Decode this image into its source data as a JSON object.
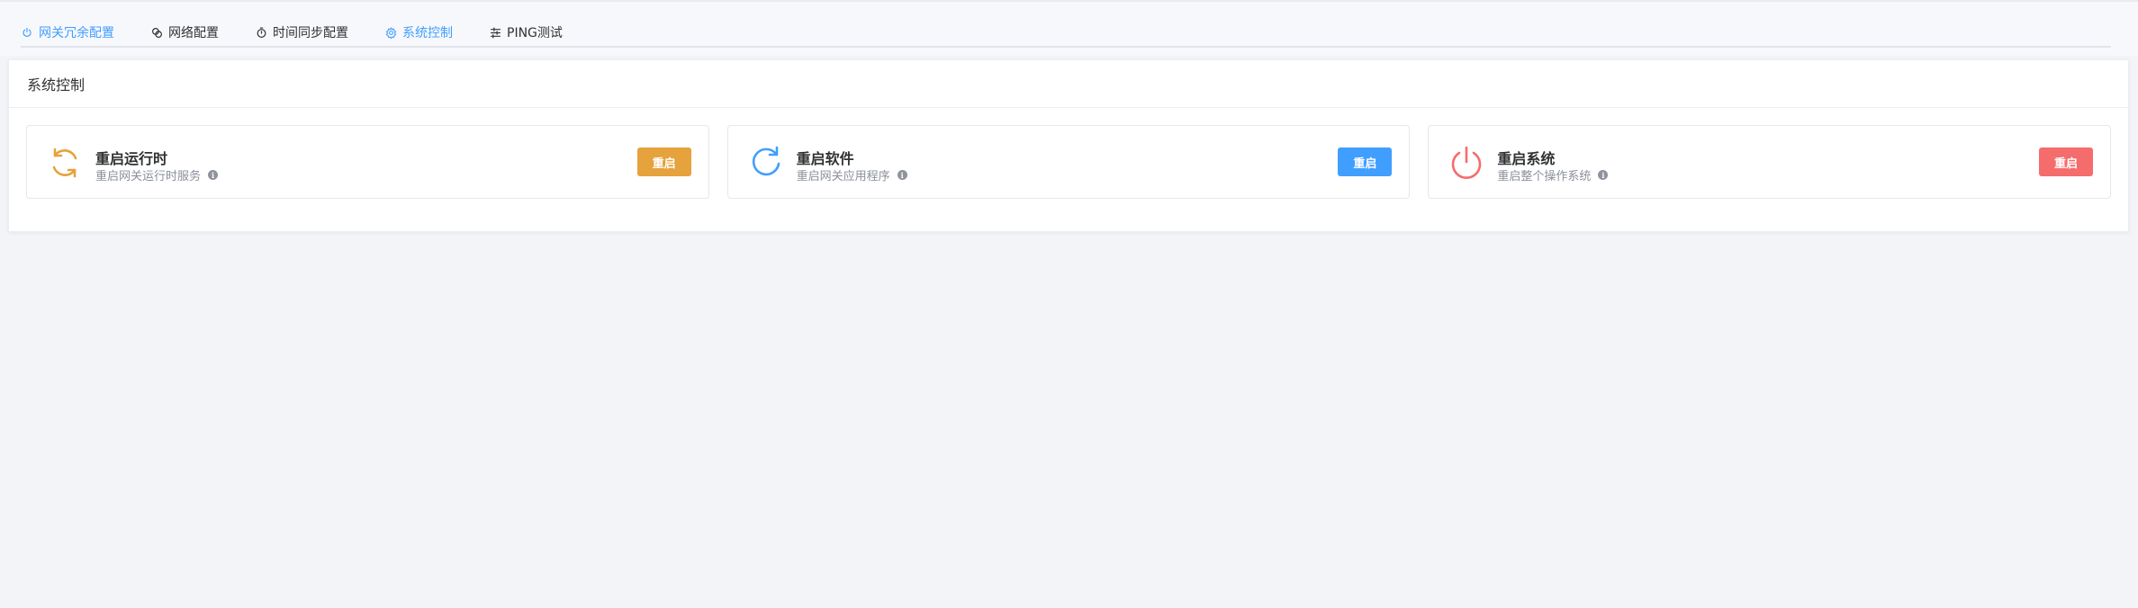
{
  "tabs": [
    {
      "label": "网关冗余配置",
      "icon": "power-icon"
    },
    {
      "label": "网络配置",
      "icon": "link-icon"
    },
    {
      "label": "时间同步配置",
      "icon": "timer-icon"
    },
    {
      "label": "系统控制",
      "icon": "gear-icon"
    },
    {
      "label": "PING测试",
      "icon": "sliders-icon"
    }
  ],
  "active_tab": "系统控制",
  "panel": {
    "title": "系统控制"
  },
  "cards": [
    {
      "title": "重启运行时",
      "desc": "重启网关运行时服务",
      "button": "重启",
      "color": "#e6a23c",
      "icon": "sync-icon"
    },
    {
      "title": "重启软件",
      "desc": "重启网关应用程序",
      "button": "重启",
      "color": "#409eff",
      "icon": "refresh-icon"
    },
    {
      "title": "重启系统",
      "desc": "重启整个操作系统",
      "button": "重启",
      "color": "#f56c6c",
      "icon": "power-icon"
    }
  ],
  "info_glyph": "i",
  "colors": {
    "accent": "#409eff",
    "warning": "#e6a23c",
    "primary": "#409eff",
    "danger": "#f56c6c"
  }
}
